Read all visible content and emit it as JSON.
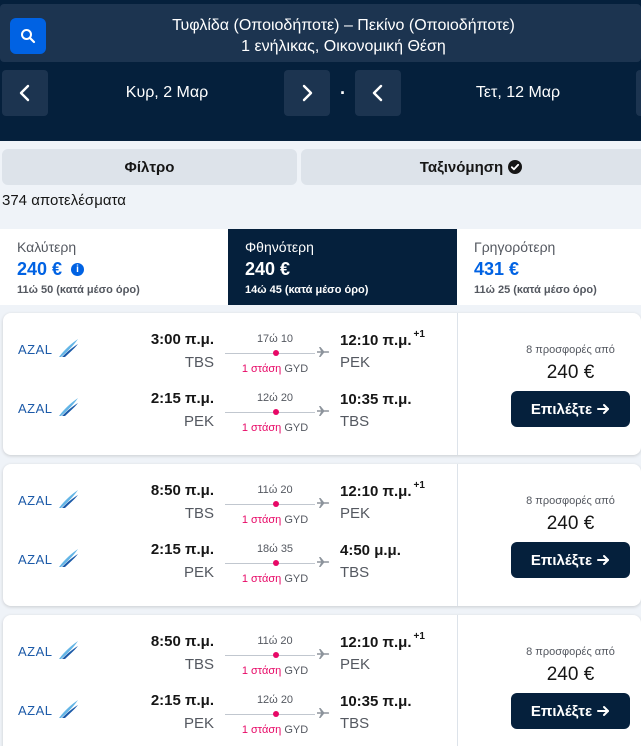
{
  "search": {
    "route": "Τυφλίδα (Οποιοδήποτε) – Πεκίνο (Οποιοδήποτε)",
    "details": "1 ενήλικας, Οικονομική Θέση"
  },
  "dates": {
    "depart": "Κυρ, 2 Μαρ",
    "return": "Τετ, 12 Μαρ",
    "separator": "·"
  },
  "controls": {
    "filter_label": "Φίλτρο",
    "sort_label": "Ταξινόμηση"
  },
  "results_count": "374 αποτελέσματα",
  "tabs": [
    {
      "label": "Καλύτερη",
      "price": "240 €",
      "sub": "11ώ 50 (κατά μέσο όρο)",
      "active": false
    },
    {
      "label": "Φθηνότερη",
      "price": "240 €",
      "sub": "14ώ 45 (κατά μέσο όρο)",
      "active": true
    },
    {
      "label": "Γρηγορότερη",
      "price": "431 €",
      "sub": "11ώ 25 (κατά μέσο όρο)",
      "active": false
    }
  ],
  "colors": {
    "header_bg": "#05203c",
    "accent_blue": "#0062e3",
    "stop_red": "#e70866"
  },
  "cards": [
    {
      "airline": "AZAL",
      "legs": [
        {
          "dep_time": "3:00 π.μ.",
          "dep_code": "TBS",
          "duration": "17ώ 10",
          "stops": "1 στάση",
          "via": "GYD",
          "arr_time": "12:10 π.μ.",
          "arr_offset": "+1",
          "arr_code": "PEK"
        },
        {
          "dep_time": "2:15 π.μ.",
          "dep_code": "PEK",
          "duration": "12ώ 20",
          "stops": "1 στάση",
          "via": "GYD",
          "arr_time": "10:35 π.μ.",
          "arr_offset": "",
          "arr_code": "TBS"
        }
      ],
      "deals": "8 προσφορές από",
      "price": "240 €",
      "select_label": "Επιλέξτε"
    },
    {
      "airline": "AZAL",
      "legs": [
        {
          "dep_time": "8:50 π.μ.",
          "dep_code": "TBS",
          "duration": "11ώ 20",
          "stops": "1 στάση",
          "via": "GYD",
          "arr_time": "12:10 π.μ.",
          "arr_offset": "+1",
          "arr_code": "PEK"
        },
        {
          "dep_time": "2:15 π.μ.",
          "dep_code": "PEK",
          "duration": "18ώ 35",
          "stops": "1 στάση",
          "via": "GYD",
          "arr_time": "4:50 μ.μ.",
          "arr_offset": "",
          "arr_code": "TBS"
        }
      ],
      "deals": "8 προσφορές από",
      "price": "240 €",
      "select_label": "Επιλέξτε"
    },
    {
      "airline": "AZAL",
      "legs": [
        {
          "dep_time": "8:50 π.μ.",
          "dep_code": "TBS",
          "duration": "11ώ 20",
          "stops": "1 στάση",
          "via": "GYD",
          "arr_time": "12:10 π.μ.",
          "arr_offset": "+1",
          "arr_code": "PEK"
        },
        {
          "dep_time": "2:15 π.μ.",
          "dep_code": "PEK",
          "duration": "12ώ 20",
          "stops": "1 στάση",
          "via": "GYD",
          "arr_time": "10:35 π.μ.",
          "arr_offset": "",
          "arr_code": "TBS"
        }
      ],
      "deals": "8 προσφορές από",
      "price": "240 €",
      "select_label": "Επιλέξτε"
    }
  ]
}
